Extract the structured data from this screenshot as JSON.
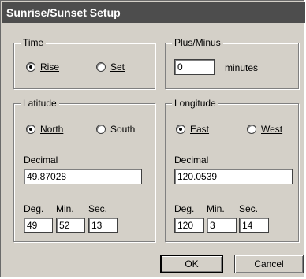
{
  "window": {
    "title": "Sunrise/Sunset Setup"
  },
  "time": {
    "legend": "Time",
    "rise_label": "Rise",
    "set_label": "Set",
    "selected": "rise"
  },
  "plus_minus": {
    "legend": "Plus/Minus",
    "value": "0",
    "unit_label": "minutes"
  },
  "latitude": {
    "legend": "Latitude",
    "north_label": "North",
    "south_label": "South",
    "selected": "north",
    "decimal_label": "Decimal",
    "decimal_value": "49.87028",
    "deg_label": "Deg.",
    "min_label": "Min.",
    "sec_label": "Sec.",
    "deg_value": "49",
    "min_value": "52",
    "sec_value": "13"
  },
  "longitude": {
    "legend": "Longitude",
    "east_label": "East",
    "west_label": "West",
    "selected": "east",
    "decimal_label": "Decimal",
    "decimal_value": "120.0539",
    "deg_label": "Deg.",
    "min_label": "Min.",
    "sec_label": "Sec.",
    "deg_value": "120",
    "min_value": "3",
    "sec_value": "14"
  },
  "buttons": {
    "ok_label": "OK",
    "cancel_label": "Cancel"
  }
}
